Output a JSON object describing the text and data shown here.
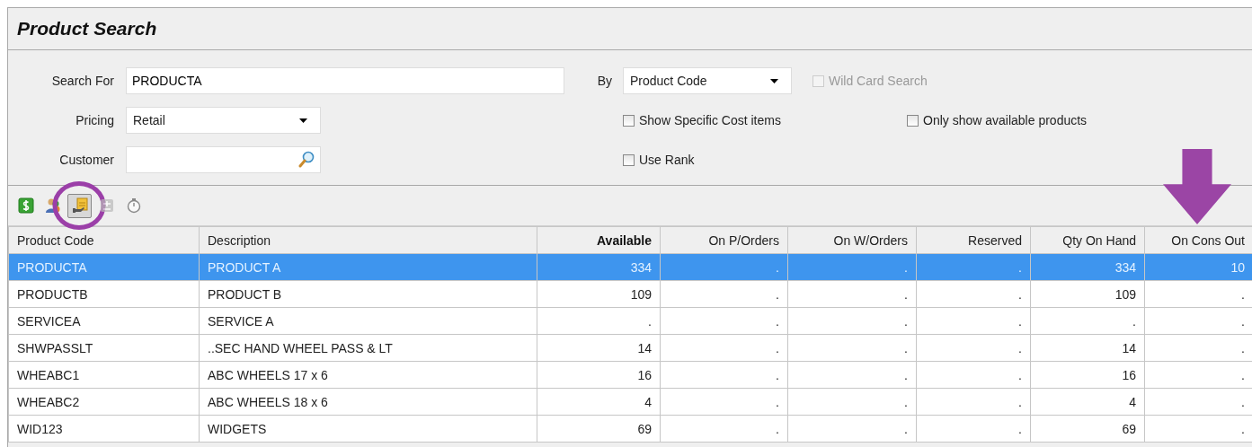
{
  "window": {
    "title": "Product Search"
  },
  "form": {
    "search_for": {
      "label": "Search For",
      "value": "PRODUCTA"
    },
    "by": {
      "label": "By",
      "value": "Product Code"
    },
    "pricing": {
      "label": "Pricing",
      "value": "Retail"
    },
    "customer": {
      "label": "Customer"
    },
    "options": [
      {
        "label": "Wild Card Search",
        "checked": false,
        "disabled": true
      },
      {
        "label": "Show Specific Cost items",
        "checked": false,
        "disabled": false
      },
      {
        "label": "Only show available products",
        "checked": false,
        "disabled": false
      },
      {
        "label": "Use Rank",
        "checked": false,
        "disabled": false
      }
    ]
  },
  "toolbar": [
    {
      "kind": "dollar",
      "selected": false,
      "disabled": false,
      "circled": false
    },
    {
      "kind": "people",
      "selected": false,
      "disabled": false,
      "circled": false
    },
    {
      "kind": "box",
      "selected": true,
      "disabled": false,
      "circled": true
    },
    {
      "kind": "plusminus",
      "selected": false,
      "disabled": true,
      "circled": false
    },
    {
      "kind": "stopwatch",
      "selected": false,
      "disabled": false,
      "circled": false
    }
  ],
  "table": {
    "columns": [
      {
        "label": "Product Code",
        "kind": "text",
        "sorted": false,
        "arrow_marked": false
      },
      {
        "label": "Description",
        "kind": "text",
        "sorted": false,
        "arrow_marked": false
      },
      {
        "label": "Available",
        "kind": "number",
        "sorted": true,
        "arrow_marked": false
      },
      {
        "label": "On P/Orders",
        "kind": "number",
        "sorted": false,
        "arrow_marked": false
      },
      {
        "label": "On W/Orders",
        "kind": "number",
        "sorted": false,
        "arrow_marked": false
      },
      {
        "label": "Reserved",
        "kind": "number",
        "sorted": false,
        "arrow_marked": false
      },
      {
        "label": "Qty On Hand",
        "kind": "number",
        "sorted": false,
        "arrow_marked": false
      },
      {
        "label": "On Cons Out",
        "kind": "number",
        "sorted": false,
        "arrow_marked": true
      }
    ],
    "rows": [
      {
        "selected": true,
        "cells": [
          "PRODUCTA",
          "PRODUCT A",
          "334",
          ".",
          ".",
          ".",
          "334",
          "10"
        ]
      },
      {
        "selected": false,
        "cells": [
          "PRODUCTB",
          "PRODUCT B",
          "109",
          ".",
          ".",
          ".",
          "109",
          "."
        ]
      },
      {
        "selected": false,
        "cells": [
          "SERVICEA",
          "SERVICE A",
          ".",
          ".",
          ".",
          ".",
          ".",
          "."
        ]
      },
      {
        "selected": false,
        "cells": [
          "SHWPASSLT",
          "..SEC HAND WHEEL PASS & LT",
          "14",
          ".",
          ".",
          ".",
          "14",
          "."
        ]
      },
      {
        "selected": false,
        "cells": [
          "WHEABC1",
          "ABC WHEELS 17 x 6",
          "16",
          ".",
          ".",
          ".",
          "16",
          "."
        ]
      },
      {
        "selected": false,
        "cells": [
          "WHEABC2",
          "ABC WHEELS 18 x 6",
          "4",
          ".",
          ".",
          ".",
          "4",
          "."
        ]
      },
      {
        "selected": false,
        "cells": [
          "WID123",
          "WIDGETS",
          "69",
          ".",
          ".",
          ".",
          "69",
          "."
        ]
      }
    ]
  }
}
